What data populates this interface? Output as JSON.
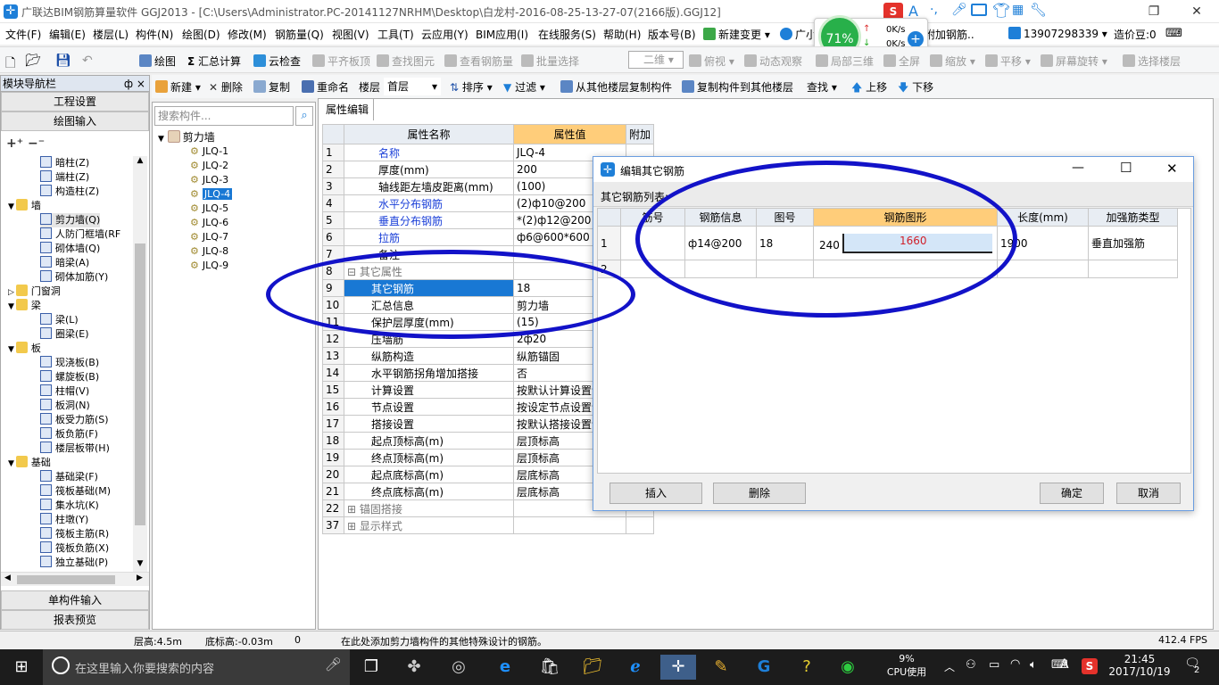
{
  "titlebar": {
    "title": "广联达BIM钢筋算量软件 GGJ2013 - [C:\\Users\\Administrator.PC-20141127NRHM\\Desktop\\白龙村-2016-08-25-13-27-07(2166版).GGJ12]",
    "icons": [
      "sogou-icon",
      "A",
      "ime-punct",
      "mic-icon",
      "keyboard-icon",
      "shirt-icon",
      "wrench-icon"
    ]
  },
  "menubar": {
    "items": [
      "文件(F)",
      "编辑(E)",
      "楼层(L)",
      "构件(N)",
      "绘图(D)",
      "修改(M)",
      "钢筋量(Q)",
      "视图(V)",
      "工具(T)",
      "云应用(Y)",
      "BIM应用(I)",
      "在线服务(S)",
      "帮助(H)",
      "版本号(B)"
    ],
    "new_change": "新建变更",
    "guangxiao": "广小",
    "add_rebar": "附加钢筋..",
    "phone": "13907298339",
    "zaojiadou": "造价豆:0"
  },
  "speedwidget": {
    "percent": "71%",
    "up": "0K/s",
    "down": "0K/s"
  },
  "toolbar1": {
    "draw": "绘图",
    "sum": "汇总计算",
    "cloud_check": "云检查",
    "flat_top": "平齐板顶",
    "find_element": "查找图元",
    "view_rebar": "查看钢筋量",
    "batch_select": "批量选择",
    "view_mode": "二维",
    "top_view": "俯视",
    "dynamic": "动态观察",
    "local3d": "局部三维",
    "fullscreen": "全屏",
    "zoom": "缩放",
    "pan": "平移",
    "rotate": "屏幕旋转",
    "select_floor": "选择楼层"
  },
  "toolbar2": {
    "new": "新建",
    "delete": "删除",
    "copy": "复制",
    "rename": "重命名",
    "floor_label": "楼层",
    "floor_value": "首层",
    "sort": "排序",
    "filter": "过滤",
    "copy_from": "从其他楼层复制构件",
    "copy_to": "复制构件到其他楼层",
    "find": "查找",
    "up": "上移",
    "down": "下移"
  },
  "left_panel": {
    "header": "模块导航栏",
    "pin": "ф ×",
    "project_settings": "工程设置",
    "draw_input": "绘图输入",
    "single_input": "单构件输入",
    "report_preview": "报表预览",
    "tree": [
      {
        "label": "暗柱(Z)",
        "level": 2
      },
      {
        "label": "端柱(Z)",
        "level": 2
      },
      {
        "label": "构造柱(Z)",
        "level": 2
      },
      {
        "label": "墙",
        "level": 1,
        "folder": true
      },
      {
        "label": "剪力墙(Q)",
        "level": 2,
        "selected": true
      },
      {
        "label": "人防门框墙(RF",
        "level": 2
      },
      {
        "label": "砌体墙(Q)",
        "level": 2
      },
      {
        "label": "暗梁(A)",
        "level": 2
      },
      {
        "label": "砌体加筋(Y)",
        "level": 2
      },
      {
        "label": "门窗洞",
        "level": 1,
        "folder": true,
        "collapsed": true
      },
      {
        "label": "梁",
        "level": 1,
        "folder": true
      },
      {
        "label": "梁(L)",
        "level": 2
      },
      {
        "label": "圈梁(E)",
        "level": 2
      },
      {
        "label": "板",
        "level": 1,
        "folder": true
      },
      {
        "label": "现浇板(B)",
        "level": 2
      },
      {
        "label": "螺旋板(B)",
        "level": 2
      },
      {
        "label": "柱帽(V)",
        "level": 2
      },
      {
        "label": "板洞(N)",
        "level": 2
      },
      {
        "label": "板受力筋(S)",
        "level": 2
      },
      {
        "label": "板负筋(F)",
        "level": 2
      },
      {
        "label": "楼层板带(H)",
        "level": 2
      },
      {
        "label": "基础",
        "level": 1,
        "folder": true
      },
      {
        "label": "基础梁(F)",
        "level": 2
      },
      {
        "label": "筏板基础(M)",
        "level": 2
      },
      {
        "label": "集水坑(K)",
        "level": 2
      },
      {
        "label": "柱墩(Y)",
        "level": 2
      },
      {
        "label": "筏板主筋(R)",
        "level": 2
      },
      {
        "label": "筏板负筋(X)",
        "level": 2
      },
      {
        "label": "独立基础(P)",
        "level": 2
      }
    ]
  },
  "component_panel": {
    "search_placeholder": "搜索构件...",
    "root": "剪力墙",
    "items": [
      "JLQ-1",
      "JLQ-2",
      "JLQ-3",
      "JLQ-4",
      "JLQ-5",
      "JLQ-6",
      "JLQ-7",
      "JLQ-8",
      "JLQ-9"
    ],
    "selected": "JLQ-4"
  },
  "property_panel": {
    "tab": "属性编辑",
    "headers": [
      "属性名称",
      "属性值",
      "附加"
    ],
    "rows": [
      {
        "num": "1",
        "name": "名称",
        "value": "JLQ-4",
        "blue": true
      },
      {
        "num": "2",
        "name": "厚度(mm)",
        "value": "200"
      },
      {
        "num": "3",
        "name": "轴线距左墙皮距离(mm)",
        "value": "(100)"
      },
      {
        "num": "4",
        "name": "水平分布钢筋",
        "value": "(2)ф10@200",
        "blue": true
      },
      {
        "num": "5",
        "name": "垂直分布钢筋",
        "value": "*(2)ф12@200",
        "blue": true
      },
      {
        "num": "6",
        "name": "拉筋",
        "value": "ф6@600*600",
        "blue": true
      },
      {
        "num": "7",
        "name": "备注",
        "value": ""
      },
      {
        "num": "8",
        "name": "其它属性",
        "value": "",
        "group": true
      },
      {
        "num": "9",
        "name": "其它钢筋",
        "value": "18",
        "selected": true,
        "indent": true
      },
      {
        "num": "10",
        "name": "汇总信息",
        "value": "剪力墙",
        "indent": true
      },
      {
        "num": "11",
        "name": "保护层厚度(mm)",
        "value": "(15)",
        "indent": true
      },
      {
        "num": "12",
        "name": "压墙筋",
        "value": "2ф20",
        "indent": true
      },
      {
        "num": "13",
        "name": "纵筋构造",
        "value": "纵筋锚固",
        "indent": true
      },
      {
        "num": "14",
        "name": "水平钢筋拐角增加搭接",
        "value": "否",
        "indent": true
      },
      {
        "num": "15",
        "name": "计算设置",
        "value": "按默认计算设置计",
        "indent": true
      },
      {
        "num": "16",
        "name": "节点设置",
        "value": "按设定节点设置计",
        "indent": true
      },
      {
        "num": "17",
        "name": "搭接设置",
        "value": "按默认搭接设置计",
        "indent": true
      },
      {
        "num": "18",
        "name": "起点顶标高(m)",
        "value": "层顶标高",
        "indent": true
      },
      {
        "num": "19",
        "name": "终点顶标高(m)",
        "value": "层顶标高",
        "indent": true
      },
      {
        "num": "20",
        "name": "起点底标高(m)",
        "value": "层底标高",
        "indent": true
      },
      {
        "num": "21",
        "name": "终点底标高(m)",
        "value": "层底标高",
        "indent": true
      },
      {
        "num": "22",
        "name": "锚固搭接",
        "value": "",
        "group": true,
        "collapsed": true
      },
      {
        "num": "37",
        "name": "显示样式",
        "value": "",
        "group": true,
        "collapsed": true
      }
    ]
  },
  "dialog": {
    "title": "编辑其它钢筋",
    "list_label": "其它钢筋列表:",
    "headers": [
      "筋号",
      "钢筋信息",
      "图号",
      "钢筋图形",
      "长度(mm)",
      "加强筋类型"
    ],
    "rows": [
      {
        "num": "1",
        "jinhao": "",
        "info": "ф14@200",
        "tuhao": "18",
        "shape_left": "240",
        "shape_main": "1660",
        "length": "1900",
        "type": "垂直加强筋"
      }
    ],
    "empty_row_num": "2",
    "btn_insert": "插入",
    "btn_delete": "删除",
    "btn_ok": "确定",
    "btn_cancel": "取消"
  },
  "statusbar": {
    "floor_height": "层高:4.5m",
    "bottom_elev": "底标高:-0.03m",
    "zero": "0",
    "message": "在此处添加剪力墙构件的其他特殊设计的钢筋。",
    "fps": "412.4 FPS"
  },
  "taskbar": {
    "search_placeholder": "在这里输入你要搜索的内容",
    "cpu_percent": "9%",
    "cpu_label": "CPU使用",
    "ime": "A",
    "time": "21:45",
    "date": "2017/10/19",
    "notif": "2"
  }
}
